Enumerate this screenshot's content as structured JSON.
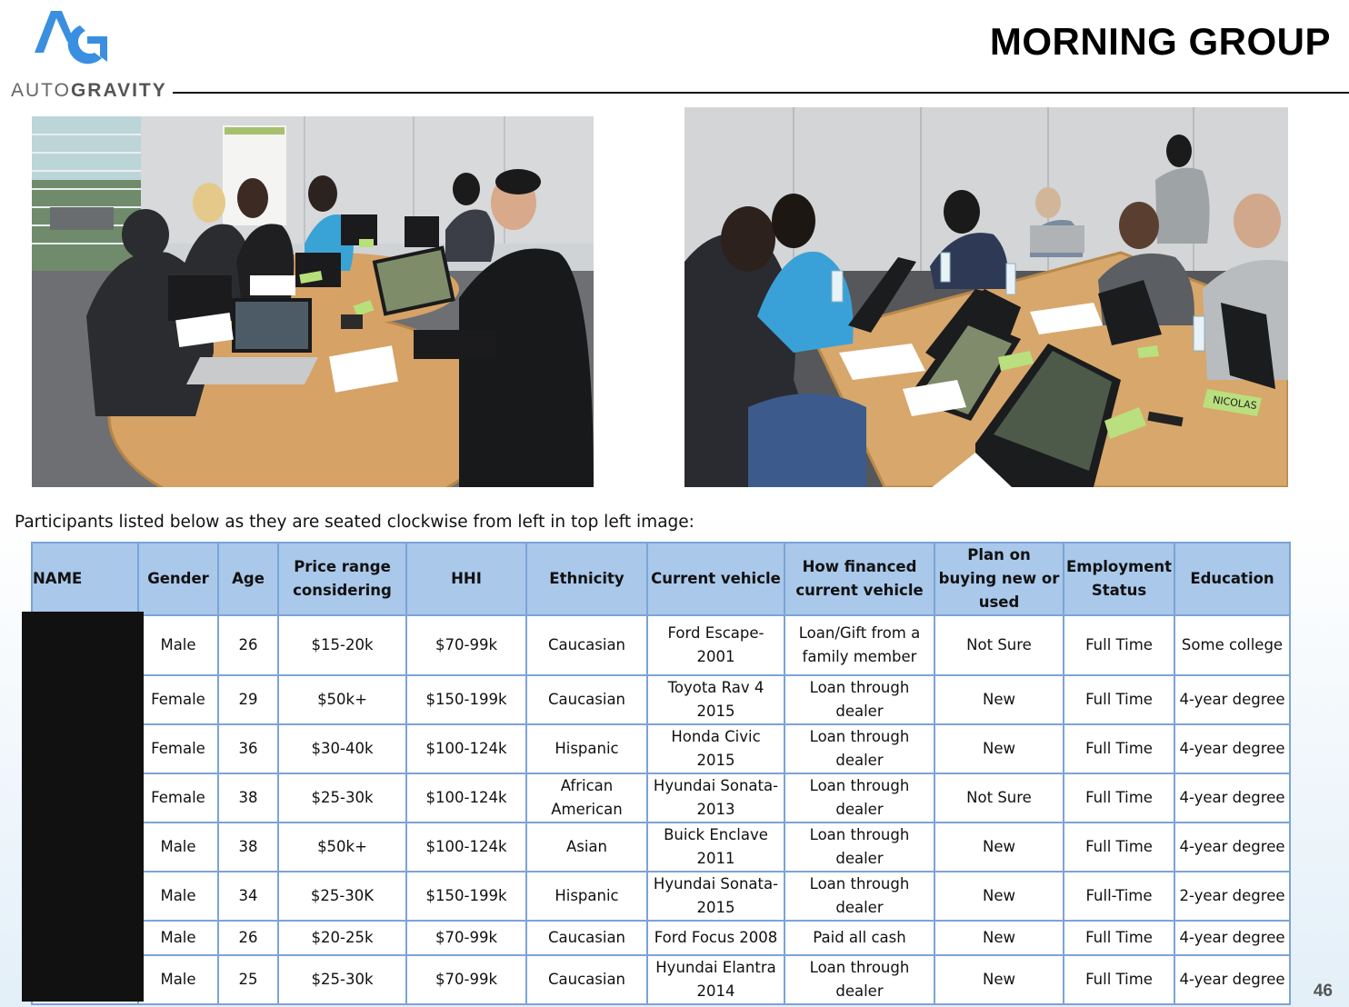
{
  "brand": {
    "logo_text_light": "AUTO",
    "logo_text_bold": "GRAVITY",
    "accent": "#3a8fe0"
  },
  "slide": {
    "title": "MORNING GROUP",
    "page_number": "46"
  },
  "photos": {
    "left": {
      "alt": "Focus group participants with laptops at a curved conference table"
    },
    "right": {
      "alt": "Focus group participants in discussion around a conference table with name tents"
    },
    "name_tents": [
      "NICOLAS"
    ]
  },
  "caption": "Participants listed below as they are seated clockwise from left in top left image:",
  "table": {
    "header_color": "#a9c8ea",
    "border_color": "#7ba4d6",
    "headers": [
      "NAME",
      "Gender",
      "Age",
      "Price range considering",
      "HHI",
      "Ethnicity",
      "Current vehicle",
      "How financed current vehicle",
      "Plan on buying new or used",
      "Employment Status",
      "Education"
    ],
    "rows": [
      [
        "",
        "Male",
        "26",
        "$15-20k",
        "$70-99k",
        "Caucasian",
        "Ford Escape-2001",
        "Loan/Gift from a family member",
        "Not Sure",
        "Full Time",
        "Some college"
      ],
      [
        "",
        "Female",
        "29",
        "$50k+",
        "$150-199k",
        "Caucasian",
        "Toyota Rav 4 2015",
        "Loan through dealer",
        "New",
        "Full Time",
        "4-year degree"
      ],
      [
        "",
        "Female",
        "36",
        "$30-40k",
        "$100-124k",
        "Hispanic",
        "Honda Civic 2015",
        "Loan through dealer",
        "New",
        "Full Time",
        "4-year degree"
      ],
      [
        "",
        "Female",
        "38",
        "$25-30k",
        "$100-124k",
        "African American",
        "Hyundai Sonata-2013",
        "Loan through dealer",
        "Not Sure",
        "Full Time",
        "4-year degree"
      ],
      [
        "",
        "Male",
        "38",
        "$50k+",
        "$100-124k",
        "Asian",
        "Buick Enclave 2011",
        "Loan through dealer",
        "New",
        "Full Time",
        "4-year degree"
      ],
      [
        "",
        "Male",
        "34",
        "$25-30K",
        "$150-199k",
        "Hispanic",
        "Hyundai Sonata-2015",
        "Loan through dealer",
        "New",
        "Full-Time",
        "2-year degree"
      ],
      [
        "",
        "Male",
        "26",
        "$20-25k",
        "$70-99k",
        "Caucasian",
        "Ford Focus 2008",
        "Paid all cash",
        "New",
        "Full Time",
        "4-year degree"
      ],
      [
        "",
        "Male",
        "25",
        "$25-30k",
        "$70-99k",
        "Caucasian",
        "Hyundai Elantra 2014",
        "Loan through dealer",
        "New",
        "Full Time",
        "4-year degree"
      ]
    ]
  }
}
